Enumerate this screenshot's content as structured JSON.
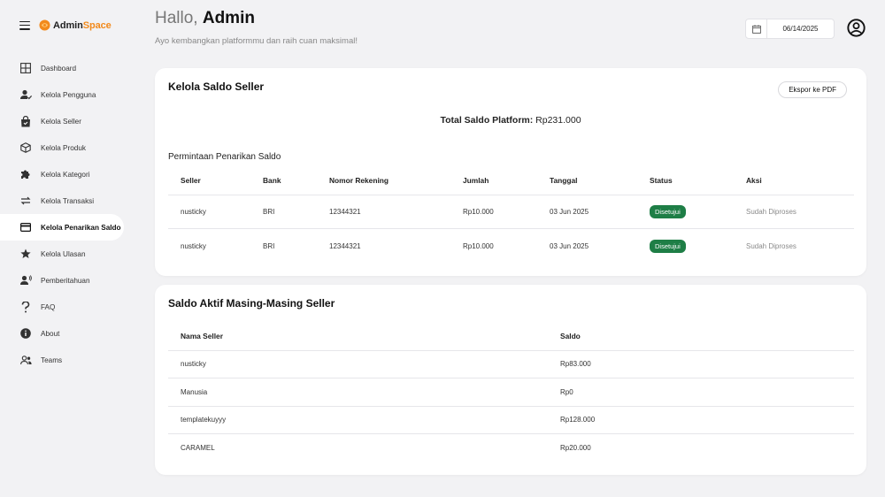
{
  "brand": {
    "name_primary": "Admin",
    "name_accent": "Space",
    "accent_color": "#f28a1c"
  },
  "sidebar": {
    "items": [
      {
        "label": "Dashboard",
        "icon": "grid-icon"
      },
      {
        "label": "Kelola Pengguna",
        "icon": "user-check-icon"
      },
      {
        "label": "Kelola Seller",
        "icon": "shopping-bag-icon"
      },
      {
        "label": "Kelola Produk",
        "icon": "box-icon"
      },
      {
        "label": "Kelola Kategori",
        "icon": "puzzle-icon"
      },
      {
        "label": "Kelola Transaksi",
        "icon": "swap-icon"
      },
      {
        "label": "Kelola Penarikan Saldo",
        "icon": "card-icon",
        "active": true
      },
      {
        "label": "Kelola Ulasan",
        "icon": "star-icon"
      },
      {
        "label": "Pemberitahuan",
        "icon": "announce-icon"
      },
      {
        "label": "FAQ",
        "icon": "question-icon"
      },
      {
        "label": "About",
        "icon": "info-icon"
      },
      {
        "label": "Teams",
        "icon": "people-icon"
      }
    ]
  },
  "header": {
    "greeting_prefix": "Hallo,",
    "greeting_name": "Admin",
    "subtitle": "Ayo kembangkan platformmu dan raih cuan maksimal!",
    "date_value": "06/14/2025"
  },
  "saldo_card": {
    "title": "Kelola Saldo Seller",
    "export_label": "Ekspor ke PDF",
    "total_label": "Total Saldo Platform:",
    "total_value": "Rp231.000",
    "withdraw_title": "Permintaan Penarikan Saldo",
    "columns": [
      "Seller",
      "Bank",
      "Nomor Rekening",
      "Jumlah",
      "Tanggal",
      "Status",
      "Aksi"
    ],
    "rows": [
      {
        "seller": "nusticky",
        "bank": "BRI",
        "rekening": "12344321",
        "jumlah": "Rp10.000",
        "tanggal": "03 Jun 2025",
        "status": "Disetujui",
        "aksi": "Sudah Diproses"
      },
      {
        "seller": "nusticky",
        "bank": "BRI",
        "rekening": "12344321",
        "jumlah": "Rp10.000",
        "tanggal": "03 Jun 2025",
        "status": "Disetujui",
        "aksi": "Sudah Diproses"
      }
    ],
    "status_color": "#1e7e46"
  },
  "aktif_card": {
    "title": "Saldo Aktif Masing-Masing Seller",
    "columns": [
      "Nama Seller",
      "Saldo"
    ],
    "rows": [
      {
        "nama": "nusticky",
        "saldo": "Rp83.000"
      },
      {
        "nama": "Manusia",
        "saldo": "Rp0"
      },
      {
        "nama": "templatekuyyy",
        "saldo": "Rp128.000"
      },
      {
        "nama": "CARAMEL",
        "saldo": "Rp20.000"
      }
    ]
  }
}
